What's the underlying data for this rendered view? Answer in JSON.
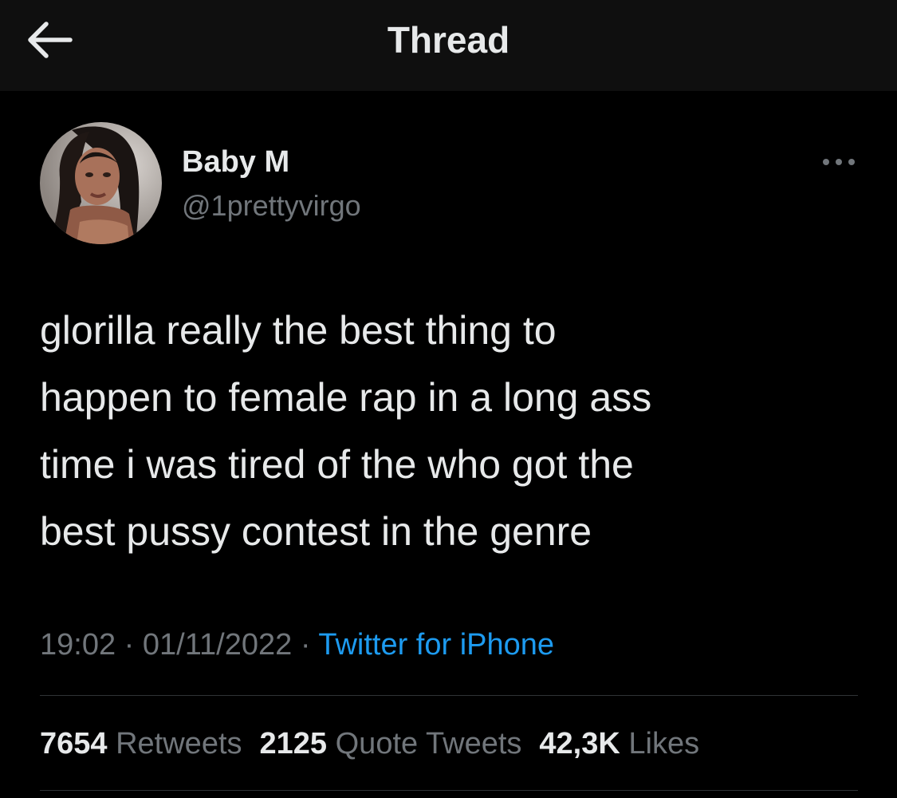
{
  "header": {
    "title": "Thread",
    "back_icon": "arrow-left-icon"
  },
  "tweet": {
    "display_name": "Baby M",
    "handle": "@1prettyvirgo",
    "text": "glorilla really the best thing to\nhappen to female rap in a long ass\ntime i was tired of the who got the\nbest pussy contest in the genre",
    "time": "19:02",
    "separator": "·",
    "date": "01/11/2022",
    "source": "Twitter for iPhone",
    "more_icon": "more-horizontal-icon"
  },
  "stats": {
    "retweets_count": "7654",
    "retweets_label": "Retweets",
    "quotes_count": "2125",
    "quotes_label": "Quote Tweets",
    "likes_count": "42,3K",
    "likes_label": "Likes"
  },
  "colors": {
    "background": "#000000",
    "header_background": "#0f0f0f",
    "primary_text": "#e7e9ea",
    "secondary_text": "#71767b",
    "link": "#1d9bf0",
    "divider": "#2f3336"
  }
}
